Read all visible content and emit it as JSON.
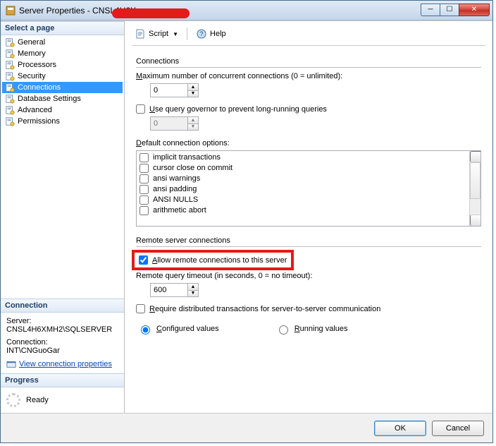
{
  "window": {
    "title": "Server Properties - CNSL4H6X"
  },
  "sidebar": {
    "header": "Select a page",
    "items": [
      {
        "label": "General"
      },
      {
        "label": "Memory"
      },
      {
        "label": "Processors"
      },
      {
        "label": "Security"
      },
      {
        "label": "Connections"
      },
      {
        "label": "Database Settings"
      },
      {
        "label": "Advanced"
      },
      {
        "label": "Permissions"
      }
    ],
    "selected_index": 4
  },
  "connection_panel": {
    "header": "Connection",
    "server_label": "Server:",
    "server_value": "CNSL4H6XMH2\\SQLSERVER",
    "conn_label": "Connection:",
    "conn_value": "INT\\CNGuoGar",
    "view_props": "View connection properties"
  },
  "progress_panel": {
    "header": "Progress",
    "status": "Ready"
  },
  "toolbar": {
    "script": "Script",
    "help": "Help"
  },
  "content": {
    "conn_header": "Connections",
    "max_conn_label": "Maximum number of concurrent connections (0 = unlimited):",
    "max_conn_value": "0",
    "use_query_gov": "Use query governor to prevent long-running queries",
    "query_gov_value": "0",
    "default_opts_label": "Default connection options:",
    "options": [
      "implicit transactions",
      "cursor close on commit",
      "ansi warnings",
      "ansi padding",
      "ANSI NULLS",
      "arithmetic abort"
    ],
    "remote_header": "Remote server connections",
    "allow_remote": "Allow remote connections to this server",
    "remote_timeout_label": "Remote query timeout (in seconds, 0 = no timeout):",
    "remote_timeout_value": "600",
    "require_dist": "Require distributed transactions for server-to-server communication",
    "configured": "Configured values",
    "running": "Running values"
  },
  "footer": {
    "ok": "OK",
    "cancel": "Cancel"
  }
}
